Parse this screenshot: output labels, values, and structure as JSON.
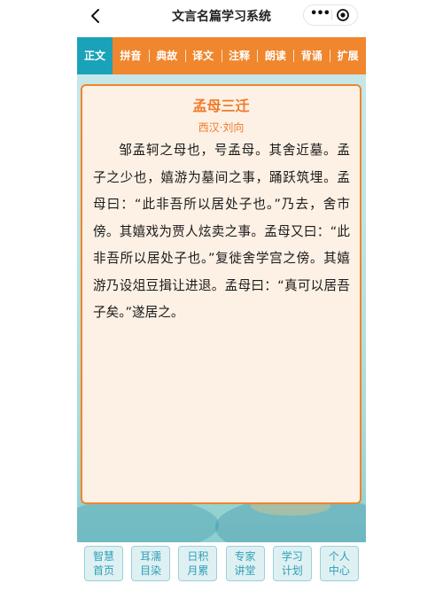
{
  "header": {
    "title": "文言名篇学习系统",
    "more_glyph": "•••",
    "back_icon": "chevron-left-icon",
    "close_icon": "target-close-icon"
  },
  "tabs": [
    {
      "label": "正文",
      "active": true
    },
    {
      "label": "拼音",
      "active": false
    },
    {
      "label": "典故",
      "active": false
    },
    {
      "label": "译文",
      "active": false
    },
    {
      "label": "注释",
      "active": false
    },
    {
      "label": "朗读",
      "active": false
    },
    {
      "label": "背诵",
      "active": false
    },
    {
      "label": "扩展",
      "active": false
    }
  ],
  "article": {
    "title": "孟母三迁",
    "author": "西汉·刘向",
    "text": "邹孟轲之母也，号孟母。其舍近墓。孟子之少也，嬉游为墓间之事，踊跃筑埋。孟母曰：“此非吾所以居处子也。”乃去，舍市傍。其嬉戏为贾人炫卖之事。孟母又曰：“此非吾所以居处子也。”复徙舍学宫之傍。其嬉游乃设俎豆揖让进退。孟母曰：“真可以居吾子矣。”遂居之。"
  },
  "bottom_nav": [
    {
      "line1": "智慧",
      "line2": "首页"
    },
    {
      "line1": "耳濡",
      "line2": "目染"
    },
    {
      "line1": "日积",
      "line2": "月累"
    },
    {
      "line1": "专家",
      "line2": "讲堂"
    },
    {
      "line1": "学习",
      "line2": "计划"
    },
    {
      "line1": "个人",
      "line2": "中心"
    }
  ],
  "colors": {
    "accent_orange": "#f0862d",
    "active_tab_teal": "#1aa2b9",
    "card_bg": "#fdf1e5",
    "nav_text": "#2da0b6"
  }
}
